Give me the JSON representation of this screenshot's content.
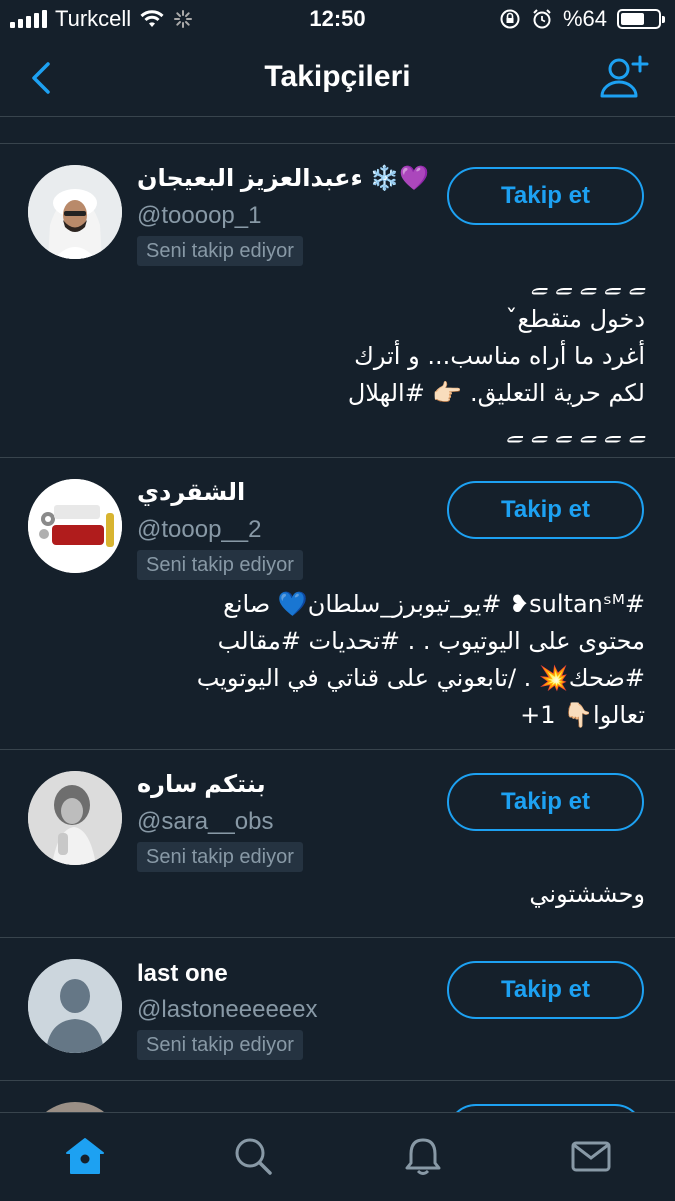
{
  "status_bar": {
    "carrier": "Turkcell",
    "time": "12:50",
    "battery": "%64",
    "battery_level": 0.64
  },
  "nav": {
    "title": "Takipçileri",
    "back_icon": "chevron-left-icon",
    "add_icon": "add-user-icon"
  },
  "followers": [
    {
      "name": "ءعبدالعزيز البعيجان ❄️💜",
      "handle": "@toooop_1",
      "badge": "Seni takip ediyor",
      "button": "Takip et",
      "bio": "ﮯ    ﮯ    ﮯ    ﮯ    ﮯ\nدخول متقطعˇ\nأغرد ما أراه مناسب... و أترك\nلكم حرية التعليق. 👉🏻 #الهلال\nﮯ    ﮯ    ﮯ    ﮯ    ﮯ    ﮯ"
    },
    {
      "name": "الشقردي",
      "handle": "@tooop__2",
      "badge": "Seni takip ediyor",
      "button": "Takip et",
      "bio": "#sultanˢᴹ❥ #يو_تيوبرز_سلطان💙 صانع\nمحتوى على اليوتيوب . . #تحديات #مقالب\n#ضحك💥 . /تابعوني على قناتي في اليوتويب\nتعالوا👇🏻 1+"
    },
    {
      "name": "بنتكم ساره",
      "handle": "@sara__obs",
      "badge": "Seni takip ediyor",
      "button": "Takip et",
      "bio": "وحششتوني"
    },
    {
      "name": "last one",
      "handle": "@lastoneeeeeex",
      "badge": "Seni takip ediyor",
      "button": "Takip et",
      "bio": ""
    }
  ],
  "tabs": [
    "home-icon",
    "search-icon",
    "notifications-icon",
    "messages-icon"
  ],
  "colors": {
    "background": "#15202b",
    "accent": "#1da1f2",
    "secondary_text": "#8899a6",
    "divider": "#38444d"
  }
}
